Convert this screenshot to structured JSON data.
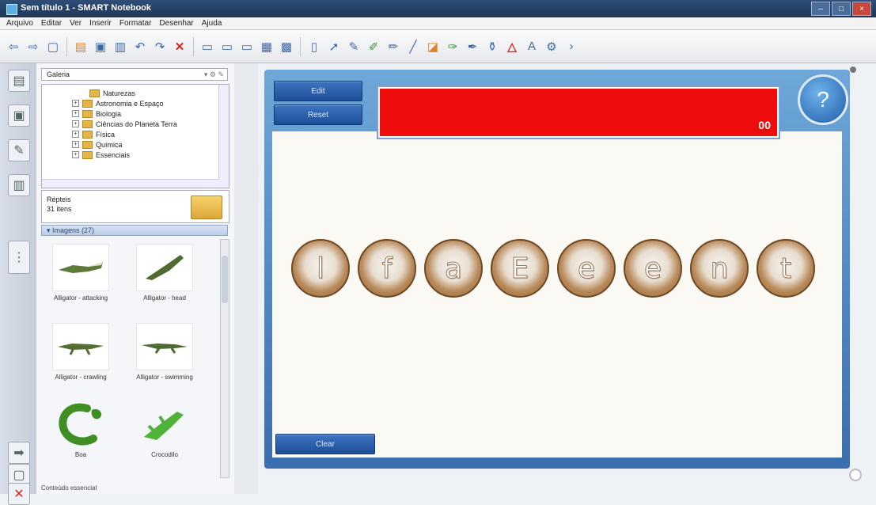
{
  "window": {
    "title": "Sem título 1 - SMART Notebook"
  },
  "menu": [
    "Arquivo",
    "Editar",
    "Ver",
    "Inserir",
    "Formatar",
    "Desenhar",
    "Ajuda"
  ],
  "gallery": {
    "search_label": "Galeria",
    "tree_items": [
      {
        "label": "Naturezas"
      },
      {
        "label": "Astronomia e Espaço"
      },
      {
        "label": "Biologia"
      },
      {
        "label": "Ciências do Planeta Terra"
      },
      {
        "label": "Física"
      },
      {
        "label": "Química"
      },
      {
        "label": "Essenciais"
      }
    ],
    "folder_info": {
      "line1": "Répteis",
      "line2": "31 itens"
    },
    "section_label": "Imagens (27)",
    "thumbnails": [
      {
        "label": "Alligator - attacking",
        "icon": "alligator-attacking"
      },
      {
        "label": "Alligator - head",
        "icon": "alligator-head"
      },
      {
        "label": "Alligator - crawling",
        "icon": "alligator-crawling"
      },
      {
        "label": "Alligator - swimming",
        "icon": "alligator-swimming"
      },
      {
        "label": "Boa",
        "icon": "snake"
      },
      {
        "label": "Crocodilo",
        "icon": "crocodile"
      }
    ],
    "status_text": "Conteúdo essencial"
  },
  "activity": {
    "buttons": {
      "edit": "Edit",
      "reset": "Reset",
      "clear": "Clear"
    },
    "score": "00",
    "help": "?",
    "letters": [
      "l",
      "f",
      "a",
      "E",
      "e",
      "e",
      "n",
      "t"
    ]
  },
  "colors": {
    "accent": "#3a6eae",
    "red_bar": "#ee0c0c",
    "bubble": "#b98a5a"
  }
}
